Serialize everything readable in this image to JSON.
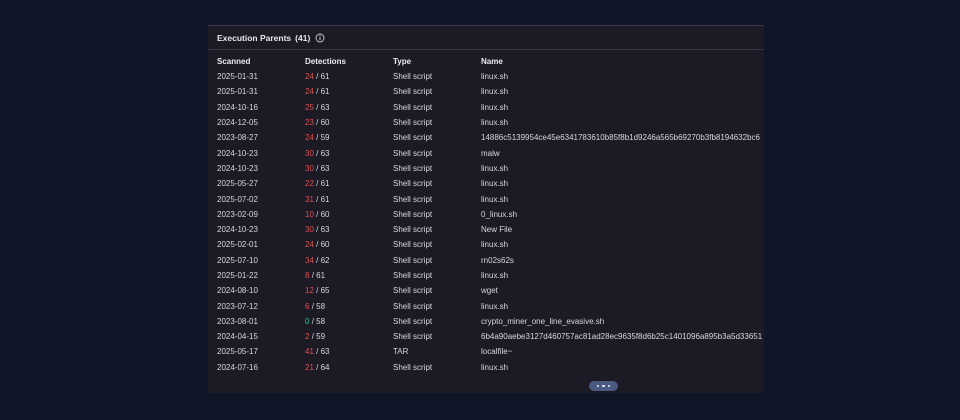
{
  "panel": {
    "title": "Execution Parents",
    "count": "(41)",
    "info_icon": "info-icon"
  },
  "table": {
    "headers": [
      "Scanned",
      "Detections",
      "Type",
      "Name"
    ],
    "rows": [
      {
        "scanned": "2025-01-31",
        "det": "24",
        "total": "/ 61",
        "det_color": "red",
        "type": "Shell script",
        "name": "linux.sh"
      },
      {
        "scanned": "2025-01-31",
        "det": "24",
        "total": "/ 61",
        "det_color": "red",
        "type": "Shell script",
        "name": "linux.sh"
      },
      {
        "scanned": "2024-10-16",
        "det": "25",
        "total": "/ 63",
        "det_color": "red",
        "type": "Shell script",
        "name": "linux.sh"
      },
      {
        "scanned": "2024-12-05",
        "det": "23",
        "total": "/ 60",
        "det_color": "red",
        "type": "Shell script",
        "name": "linux.sh"
      },
      {
        "scanned": "2023-08-27",
        "det": "24",
        "total": "/ 59",
        "det_color": "red",
        "type": "Shell script",
        "name": "14886c5139954ce45e6341783610b85f8b1d9246a565b69270b3fb8194632bc6"
      },
      {
        "scanned": "2024-10-23",
        "det": "30",
        "total": "/ 63",
        "det_color": "red",
        "type": "Shell script",
        "name": "malw"
      },
      {
        "scanned": "2024-10-23",
        "det": "30",
        "total": "/ 63",
        "det_color": "red",
        "type": "Shell script",
        "name": "linux.sh"
      },
      {
        "scanned": "2025-05-27",
        "det": "22",
        "total": "/ 61",
        "det_color": "red",
        "type": "Shell script",
        "name": "linux.sh"
      },
      {
        "scanned": "2025-07-02",
        "det": "31",
        "total": "/ 61",
        "det_color": "red",
        "type": "Shell script",
        "name": "linux.sh"
      },
      {
        "scanned": "2023-02-09",
        "det": "10",
        "total": "/ 60",
        "det_color": "red",
        "type": "Shell script",
        "name": "0_linux.sh"
      },
      {
        "scanned": "2024-10-23",
        "det": "30",
        "total": "/ 63",
        "det_color": "red",
        "type": "Shell script",
        "name": "New File"
      },
      {
        "scanned": "2025-02-01",
        "det": "24",
        "total": "/ 60",
        "det_color": "red",
        "type": "Shell script",
        "name": "linux.sh"
      },
      {
        "scanned": "2025-07-10",
        "det": "34",
        "total": "/ 62",
        "det_color": "red",
        "type": "Shell script",
        "name": "rn02s62s"
      },
      {
        "scanned": "2025-01-22",
        "det": "8",
        "total": "/ 61",
        "det_color": "red",
        "type": "Shell script",
        "name": "linux.sh"
      },
      {
        "scanned": "2024-08-10",
        "det": "12",
        "total": "/ 65",
        "det_color": "red",
        "type": "Shell script",
        "name": "wget"
      },
      {
        "scanned": "2023-07-12",
        "det": "6",
        "total": "/ 58",
        "det_color": "red",
        "type": "Shell script",
        "name": "linux.sh"
      },
      {
        "scanned": "2023-08-01",
        "det": "0",
        "total": "/ 58",
        "det_color": "green",
        "type": "Shell script",
        "name": "crypto_miner_one_line_evasive.sh"
      },
      {
        "scanned": "2024-04-15",
        "det": "2",
        "total": "/ 59",
        "det_color": "red",
        "type": "Shell script",
        "name": "6b4a90aebe3127d460757ac81ad28ec9635f8d6b25c1401096a895b3a5d33651"
      },
      {
        "scanned": "2025-05-17",
        "det": "41",
        "total": "/ 63",
        "det_color": "red",
        "type": "TAR",
        "name": "localfile~"
      },
      {
        "scanned": "2024-07-16",
        "det": "21",
        "total": "/ 64",
        "det_color": "red",
        "type": "Shell script",
        "name": "linux.sh"
      }
    ]
  },
  "more_button": {
    "icon": "ellipsis-icon"
  },
  "colors": {
    "page_bg": "#0f1628",
    "panel_bg": "#1b1a25",
    "detection_red": "#e05252",
    "detection_green": "#3cc78a",
    "more_button_bg": "#4a5a80"
  }
}
